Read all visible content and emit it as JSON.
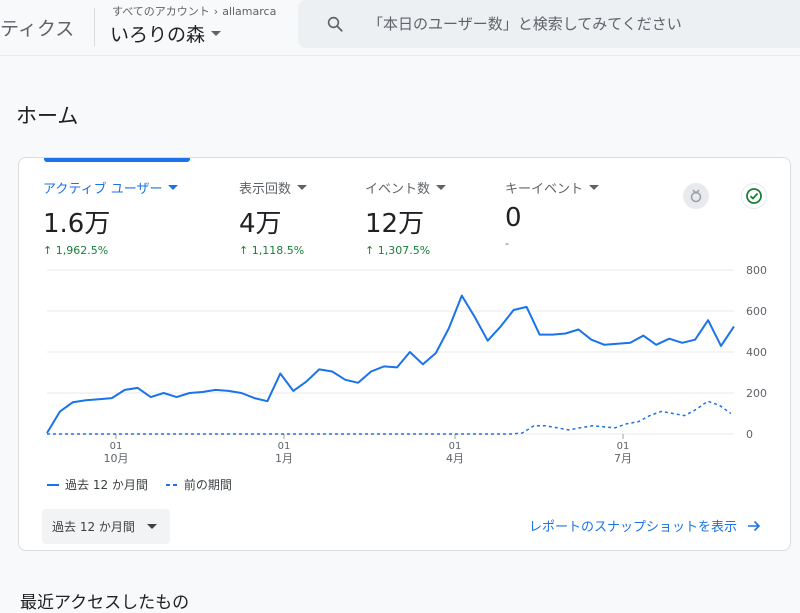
{
  "header": {
    "app_name": "ティクス",
    "breadcrumb": "すべてのアカウント",
    "account": "allamarca",
    "property": "いろりの森",
    "search_placeholder": "「本日のユーザー数」と検索してみてください"
  },
  "page_title": "ホーム",
  "metrics": [
    {
      "label": "アクティブ ユーザー",
      "value": "1.6万",
      "change": "1,962.5%",
      "active": true
    },
    {
      "label": "表示回数",
      "value": "4万",
      "change": "1,118.5%",
      "active": false
    },
    {
      "label": "イベント数",
      "value": "12万",
      "change": "1,307.5%",
      "active": false
    },
    {
      "label": "キーイベント",
      "value": "0",
      "change": "-",
      "active": false
    }
  ],
  "chart_data": {
    "type": "line",
    "y_ticks": [
      "800",
      "600",
      "400",
      "200",
      "0"
    ],
    "ylim": [
      0,
      800
    ],
    "x_tick_labels": [
      {
        "day": "01",
        "month": "10月"
      },
      {
        "day": "01",
        "month": "1月"
      },
      {
        "day": "01",
        "month": "4月"
      },
      {
        "day": "01",
        "month": "7月"
      }
    ],
    "series": [
      {
        "name": "過去 12 か月間",
        "style": "solid",
        "color": "#1a73e8",
        "values": [
          5,
          110,
          155,
          165,
          170,
          175,
          215,
          225,
          180,
          200,
          180,
          200,
          205,
          215,
          210,
          200,
          175,
          160,
          295,
          210,
          255,
          315,
          305,
          265,
          250,
          305,
          330,
          325,
          400,
          340,
          395,
          515,
          675,
          570,
          455,
          525,
          605,
          620,
          485,
          485,
          490,
          510,
          460,
          435,
          440,
          445,
          480,
          435,
          465,
          445,
          460,
          555,
          430,
          525
        ]
      },
      {
        "name": "前の期間",
        "style": "dashed",
        "color": "#1a73e8",
        "values": [
          0,
          0,
          0,
          0,
          0,
          0,
          0,
          0,
          0,
          0,
          0,
          0,
          0,
          0,
          0,
          0,
          0,
          0,
          0,
          0,
          0,
          0,
          0,
          0,
          0,
          0,
          0,
          0,
          0,
          0,
          0,
          0,
          0,
          0,
          0,
          0,
          0,
          0,
          0,
          0,
          0,
          5,
          40,
          40,
          30,
          20,
          30,
          40,
          35,
          30,
          50,
          60,
          90,
          110,
          100,
          90,
          120,
          160,
          140,
          100
        ]
      }
    ]
  },
  "period_label": "過去 12 か月間",
  "snapshot_link": "レポートのスナップショットを表示",
  "bottom_text": "最近アクセスしたもの"
}
